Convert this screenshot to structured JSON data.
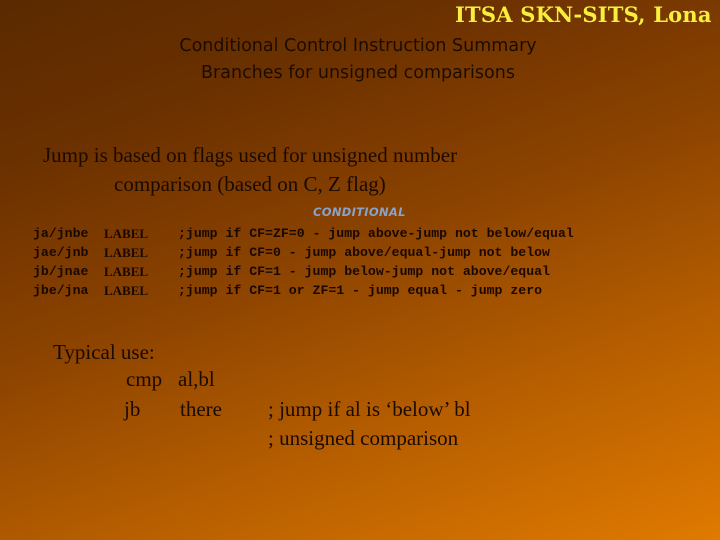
{
  "header": {
    "brand": "ITSA SKN-SITS, Lona",
    "title_line1": "Conditional Control Instruction Summary",
    "title_line2": "Branches for unsigned comparisons"
  },
  "intro": {
    "line1": "Jump is based on flags used for unsigned number",
    "line2": "comparison (based on C, Z flag)"
  },
  "table": {
    "header": "CONDITIONAL",
    "rows": [
      {
        "mnemonic": "ja/jnbe",
        "operand": "LABEL",
        "comment": ";jump if CF=ZF=0 - jump above-jump not below/equal"
      },
      {
        "mnemonic": "jae/jnb",
        "operand": "LABEL",
        "comment": ";jump if CF=0 - jump above/equal-jump not below"
      },
      {
        "mnemonic": "jb/jnae",
        "operand": "LABEL",
        "comment": ";jump if CF=1 - jump below-jump not above/equal"
      },
      {
        "mnemonic": "jbe/jna",
        "operand": "LABEL",
        "comment": ";jump if CF=1 or ZF=1 - jump equal - jump zero"
      }
    ]
  },
  "typical_use": {
    "heading": "Typical use:",
    "lines": [
      {
        "op": "cmp",
        "arg": "al,bl",
        "comment": ""
      },
      {
        "op": "jb",
        "arg": "there",
        "comment": "; jump if al is ‘below’ bl"
      },
      {
        "op": "",
        "arg": "",
        "comment": "; unsigned comparison"
      }
    ]
  },
  "colors": {
    "brand": "#f7ef3e",
    "conditional_header": "#8aa2c8",
    "text": "#1a0a00"
  }
}
